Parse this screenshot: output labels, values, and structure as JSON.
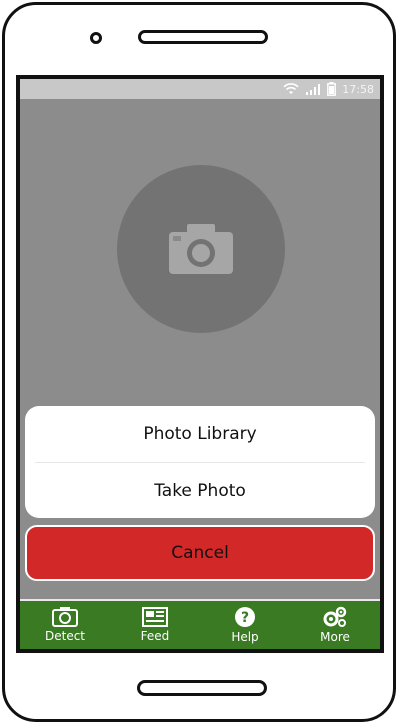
{
  "status_bar": {
    "time": "17:58"
  },
  "photo_placeholder": {
    "icon": "camera-icon"
  },
  "action_sheet": {
    "items": [
      {
        "label": "Photo Library"
      },
      {
        "label": "Take Photo"
      }
    ],
    "cancel_label": "Cancel"
  },
  "tab_bar": {
    "items": [
      {
        "label": "Detect",
        "icon": "camera-icon"
      },
      {
        "label": "Feed",
        "icon": "newspaper-icon"
      },
      {
        "label": "Help",
        "icon": "help-icon"
      },
      {
        "label": "More",
        "icon": "gears-icon"
      }
    ]
  },
  "colors": {
    "tab_bar_bg": "#3a7a22",
    "cancel_bg": "#d32828",
    "overlay_bg": "#8c8c8c"
  }
}
